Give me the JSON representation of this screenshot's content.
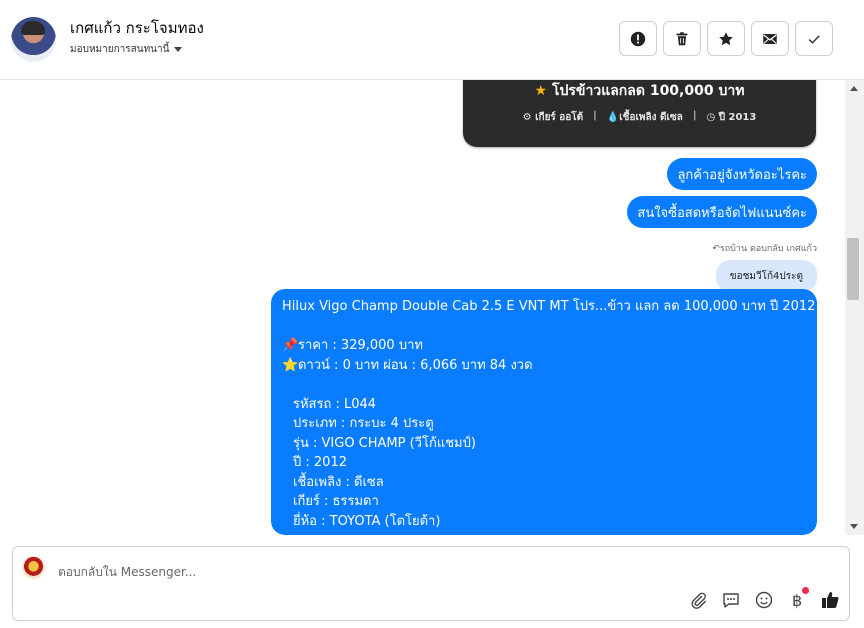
{
  "header": {
    "name": "เกศแก้ว กระโจมทอง",
    "assign_label": "มอบหมายการสนทนานี้",
    "actions": [
      {
        "name": "report-button",
        "icon": "exclamation-icon"
      },
      {
        "name": "delete-button",
        "icon": "trash-icon"
      },
      {
        "name": "star-button",
        "icon": "star-icon"
      },
      {
        "name": "mark-unread-button",
        "icon": "envelope-icon"
      },
      {
        "name": "done-button",
        "icon": "checkmark-icon"
      }
    ]
  },
  "card": {
    "title": "โปรข้าวแลกลด 100,000 บาท",
    "gear": "เกียร์ ออโต้",
    "fuel": "เชื้อเพลิง ดีเซล",
    "year": "ปี 2013"
  },
  "messages": {
    "m1": "ลูกค้าอยู่จังหวัดอะไรคะ",
    "m2": "สนใจซื้อสดหรือจัดไฟแนนซ์คะ",
    "reply_meta": "รถบ้าน ตอบกลับ เกศแก้ว",
    "reply_quote": "ขอชมวีโก้4ประตู",
    "big": {
      "title": "Hilux Vigo Champ Double Cab 2.5 E VNT MT โปร...ข้าว แลก ลด 100,000 บาท ปี 2012",
      "price": "ราคา : 329,000 บาท",
      "down": "ดาวน์ : 0 บาท ผ่อน : 6,066 บาท 84 งวด",
      "code": "รหัสรถ : L044",
      "type": "ประเภท : กระบะ 4 ประตู",
      "model": "รุ่น : VIGO CHAMP (วีโก้แชมป์)",
      "year": "ปี : 2012",
      "fuel": "เชื้อเพลิง : ดีเซล",
      "gear": "เกียร์ : ธรรมดา",
      "brand": "ยี่ห้อ : TOYOTA (โตโยต้า)"
    }
  },
  "composer": {
    "placeholder": "ตอบกลับใน Messenger..."
  },
  "colors": {
    "bubble": "#0a7cff",
    "quote": "#d9e7fc",
    "card": "#2b2b2b",
    "accent_star": "#f5b400",
    "notification_dot": "#f02849"
  }
}
